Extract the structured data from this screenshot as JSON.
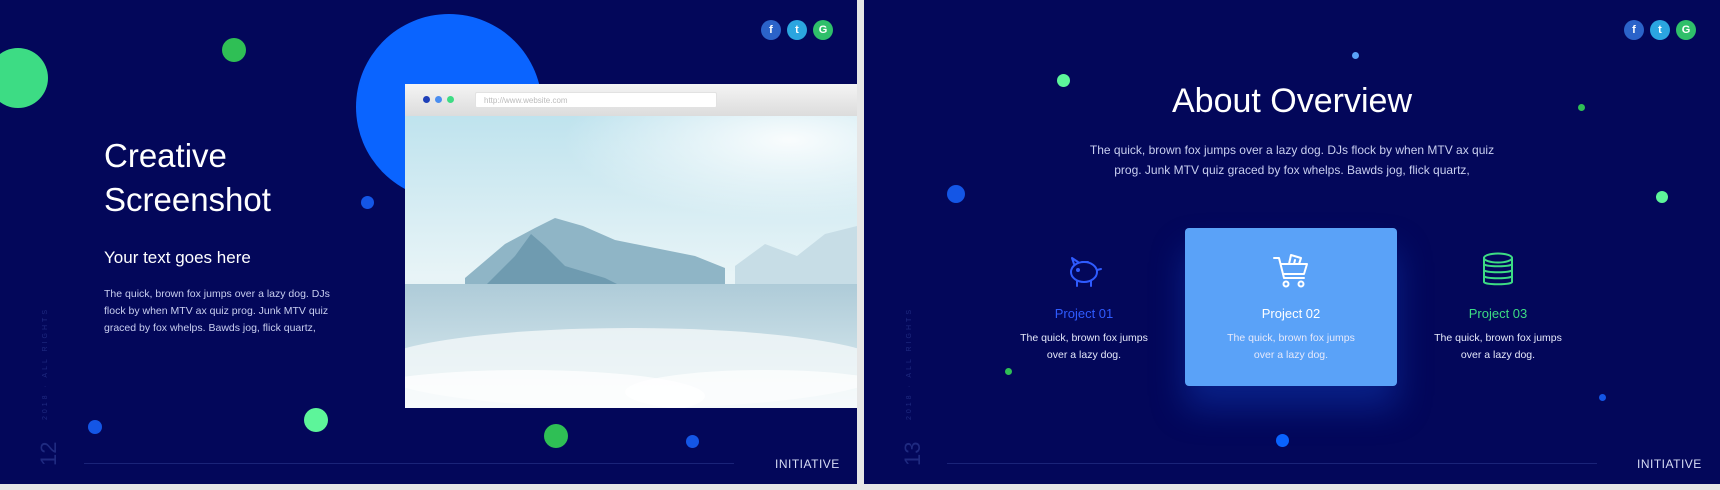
{
  "left": {
    "title_line1": "Creative",
    "title_line2": "Screenshot",
    "subtitle": "Your text goes here",
    "body": "The quick, brown fox jumps over a lazy dog. DJs flock by when MTV ax quiz prog. Junk MTV quiz graced by fox whelps. Bawds jog, flick quartz,",
    "browser_url": "http://www.website.com",
    "page_number": "12",
    "vertical_meta": "2018 · ALL RIGHTS",
    "footer": "INITIATIVE"
  },
  "right": {
    "title": "About Overview",
    "body": "The quick, brown fox jumps over a lazy dog. DJs flock by when MTV ax quiz prog. Junk MTV quiz graced by fox whelps. Bawds jog, flick quartz,",
    "projects": [
      {
        "title": "Project 01",
        "text": "The quick, brown fox jumps over a lazy dog.",
        "icon": "piggy-bank-icon",
        "color": "#2f5bff"
      },
      {
        "title": "Project 02",
        "text": "The quick, brown fox jumps over a lazy dog.",
        "icon": "shopping-cart-icon",
        "color": "#ffffff"
      },
      {
        "title": "Project 03",
        "text": "The quick, brown fox jumps over a lazy dog.",
        "icon": "coins-icon",
        "color": "#3ddc84"
      }
    ],
    "page_number": "13",
    "vertical_meta": "2018 · ALL RIGHTS",
    "footer": "INITIATIVE"
  },
  "social": {
    "facebook": "f",
    "twitter": "t",
    "google": "G"
  },
  "colors": {
    "background": "#03075a",
    "accent_blue": "#0a64ff",
    "accent_green": "#3ddc84",
    "card_blue": "#5aa2f8"
  }
}
